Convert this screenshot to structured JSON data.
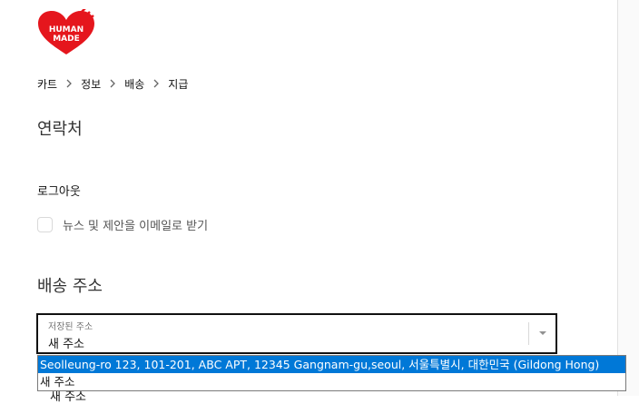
{
  "logo": {
    "line1": "HUMAN",
    "line2": "MADE",
    "color": "#e5161d"
  },
  "breadcrumb": [
    "카트",
    "정보",
    "배송",
    "지급"
  ],
  "contact": {
    "heading": "연락처",
    "logout": "로그아웃",
    "newsletter_label": "뉴스 및 제안을 이메일로 받기"
  },
  "shipping": {
    "heading": "배송 주소",
    "saved_address_label": "저장된 주소",
    "saved_address_value": "새 주소",
    "options": [
      "Seolleung-ro 123, 101-201, ABC APT, 12345 Gangnam-gu,seoul, 서울특별시, 대한민국 (Gildong Hong)",
      "새 주소"
    ],
    "highlighted_option": 0,
    "partially_hidden_text": "새 주소"
  },
  "colors": {
    "highlight": "#0078d7",
    "border": "#111111",
    "muted_text": "#545454"
  }
}
